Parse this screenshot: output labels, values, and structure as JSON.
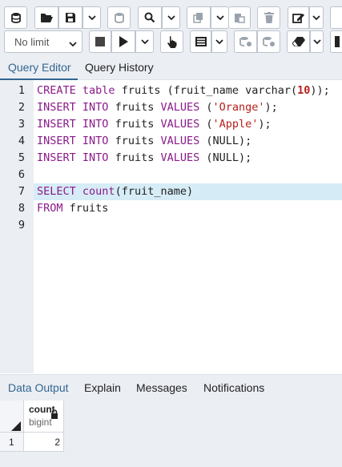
{
  "toolbar": {
    "limit_value": "No limit",
    "icons_row1": [
      "database-icon",
      "open-folder-icon",
      "save-icon",
      "chevron-down-icon",
      "server-icon",
      "search-icon",
      "chevron-down-icon",
      "copy-icon",
      "chevron-down-icon",
      "paste-icon",
      "delete-icon",
      "edit-icon",
      "chevron-down-icon"
    ],
    "icons_row2": [
      "stop-icon",
      "play-icon",
      "chevron-down-icon",
      "pointer-icon",
      "list-icon",
      "chevron-down-icon",
      "commit-icon",
      "rollback-icon",
      "eraser-icon",
      "chevron-down-icon"
    ]
  },
  "editor_tabs": [
    {
      "label": "Query Editor",
      "active": true
    },
    {
      "label": "Query History",
      "active": false
    }
  ],
  "editor": {
    "lines": [
      {
        "n": "1",
        "tokens": [
          [
            "kw",
            "CREATE"
          ],
          [
            "t",
            " "
          ],
          [
            "kw",
            "table"
          ],
          [
            "t",
            " fruits (fruit_name varchar("
          ],
          [
            "num",
            "10"
          ],
          [
            "t",
            "));"
          ]
        ]
      },
      {
        "n": "2",
        "tokens": [
          [
            "kw",
            "INSERT"
          ],
          [
            "t",
            " "
          ],
          [
            "kw",
            "INTO"
          ],
          [
            "t",
            " fruits "
          ],
          [
            "kw",
            "VALUES"
          ],
          [
            "t",
            " ("
          ],
          [
            "str",
            "'Orange'"
          ],
          [
            "t",
            ");"
          ]
        ]
      },
      {
        "n": "3",
        "tokens": [
          [
            "kw",
            "INSERT"
          ],
          [
            "t",
            " "
          ],
          [
            "kw",
            "INTO"
          ],
          [
            "t",
            " fruits "
          ],
          [
            "kw",
            "VALUES"
          ],
          [
            "t",
            " ("
          ],
          [
            "str",
            "'Apple'"
          ],
          [
            "t",
            ");"
          ]
        ]
      },
      {
        "n": "4",
        "tokens": [
          [
            "kw",
            "INSERT"
          ],
          [
            "t",
            " "
          ],
          [
            "kw",
            "INTO"
          ],
          [
            "t",
            " fruits "
          ],
          [
            "kw",
            "VALUES"
          ],
          [
            "t",
            " (NULL);"
          ]
        ]
      },
      {
        "n": "5",
        "tokens": [
          [
            "kw",
            "INSERT"
          ],
          [
            "t",
            " "
          ],
          [
            "kw",
            "INTO"
          ],
          [
            "t",
            " fruits "
          ],
          [
            "kw",
            "VALUES"
          ],
          [
            "t",
            " (NULL);"
          ]
        ]
      },
      {
        "n": "6",
        "tokens": []
      },
      {
        "n": "7",
        "tokens": [
          [
            "kw",
            "SELECT"
          ],
          [
            "t",
            " "
          ],
          [
            "kw",
            "count"
          ],
          [
            "t",
            "(fruit_name)"
          ]
        ],
        "highlight": true
      },
      {
        "n": "8",
        "tokens": [
          [
            "kw",
            "FROM"
          ],
          [
            "t",
            " fruits"
          ]
        ]
      },
      {
        "n": "9",
        "tokens": []
      }
    ]
  },
  "output_tabs": [
    {
      "label": "Data Output",
      "active": true
    },
    {
      "label": "Explain",
      "active": false
    },
    {
      "label": "Messages",
      "active": false
    },
    {
      "label": "Notifications",
      "active": false
    }
  ],
  "result_grid": {
    "columns": [
      {
        "name": "count",
        "type": "bigint"
      }
    ],
    "rows": [
      {
        "num": "1",
        "values": [
          "2"
        ]
      }
    ]
  },
  "colors": {
    "accent": "#326690",
    "keyword": "#8a1a8a",
    "string": "#b8201c",
    "highlight": "#d6ecf6"
  }
}
